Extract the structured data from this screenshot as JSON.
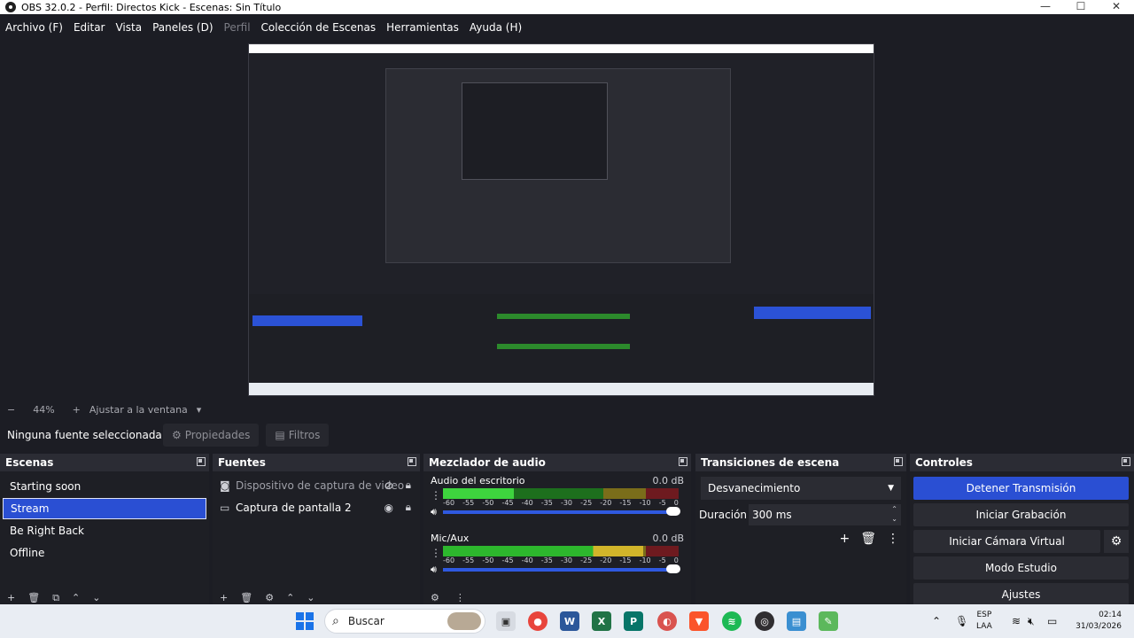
{
  "window": {
    "title": "OBS 32.0.2 - Perfil: Directos Kick - Escenas: Sin Título",
    "minimize": "—",
    "maximize": "☐",
    "close": "✕"
  },
  "menu": [
    {
      "label": "Archivo (F)",
      "enabled": true
    },
    {
      "label": "Editar",
      "enabled": true
    },
    {
      "label": "Vista",
      "enabled": true
    },
    {
      "label": "Paneles (D)",
      "enabled": true
    },
    {
      "label": "Perfil",
      "enabled": false
    },
    {
      "label": "Colección de Escenas",
      "enabled": true
    },
    {
      "label": "Herramientas",
      "enabled": true
    },
    {
      "label": "Ayuda (H)",
      "enabled": true
    }
  ],
  "zoom": {
    "minus": "−",
    "value": "44%",
    "plus": "+",
    "fit_label": "Ajustar a la ventana",
    "chevron": "▾"
  },
  "source_toolbar": {
    "no_selection": "Ninguna fuente seleccionada",
    "properties_label": "Propiedades",
    "filters_label": "Filtros"
  },
  "scenes": {
    "title": "Escenas",
    "items": [
      "Starting soon",
      "Stream",
      "Be Right Back",
      "Offline"
    ],
    "selected": "Stream",
    "footer": [
      "+",
      "🗑",
      "⧉",
      "⌃",
      "⌄"
    ]
  },
  "sources": {
    "title": "Fuentes",
    "items": [
      {
        "icon": "camera-icon",
        "label": "Dispositivo de captura de video",
        "visible": false
      },
      {
        "icon": "monitor-icon",
        "label": "Captura de pantalla 2",
        "visible": true
      }
    ],
    "footer": [
      "+",
      "🗑",
      "⚙",
      "⌃",
      "⌄"
    ]
  },
  "mixer": {
    "title": "Mezclador de audio",
    "ticks": [
      "-60",
      "-55",
      "-50",
      "-45",
      "-40",
      "-35",
      "-30",
      "-25",
      "-20",
      "-15",
      "-10",
      "-5",
      "0"
    ],
    "channels": [
      {
        "name": "Audio del escritorio",
        "db": "0.0 dB",
        "level": 0.3,
        "volume": 1.0
      },
      {
        "name": "Mic/Aux",
        "db": "0.0 dB",
        "level": 0.85,
        "volume": 1.0
      }
    ]
  },
  "transitions": {
    "title": "Transiciones de escena",
    "selected": "Desvanecimiento",
    "duration_label": "Duración",
    "duration_value": "300 ms"
  },
  "controls": {
    "title": "Controles",
    "stop_stream": "Detener Transmisión",
    "start_recording": "Iniciar Grabación",
    "start_virtual_cam": "Iniciar Cámara Virtual",
    "studio_mode": "Modo Estudio",
    "settings": "Ajustes"
  },
  "taskbar": {
    "search_placeholder": "Buscar",
    "lang_top": "ESP",
    "lang_bottom": "LAA",
    "time": "02:14",
    "date": "31/03/2026",
    "colors": {
      "chrome": "#e8453c",
      "word": "#2b579a",
      "excel": "#217346",
      "publisher": "#077568",
      "brave": "#fb542b",
      "spotify": "#1db954",
      "obs": "#302e31",
      "accent": "#2a4fd3"
    }
  }
}
